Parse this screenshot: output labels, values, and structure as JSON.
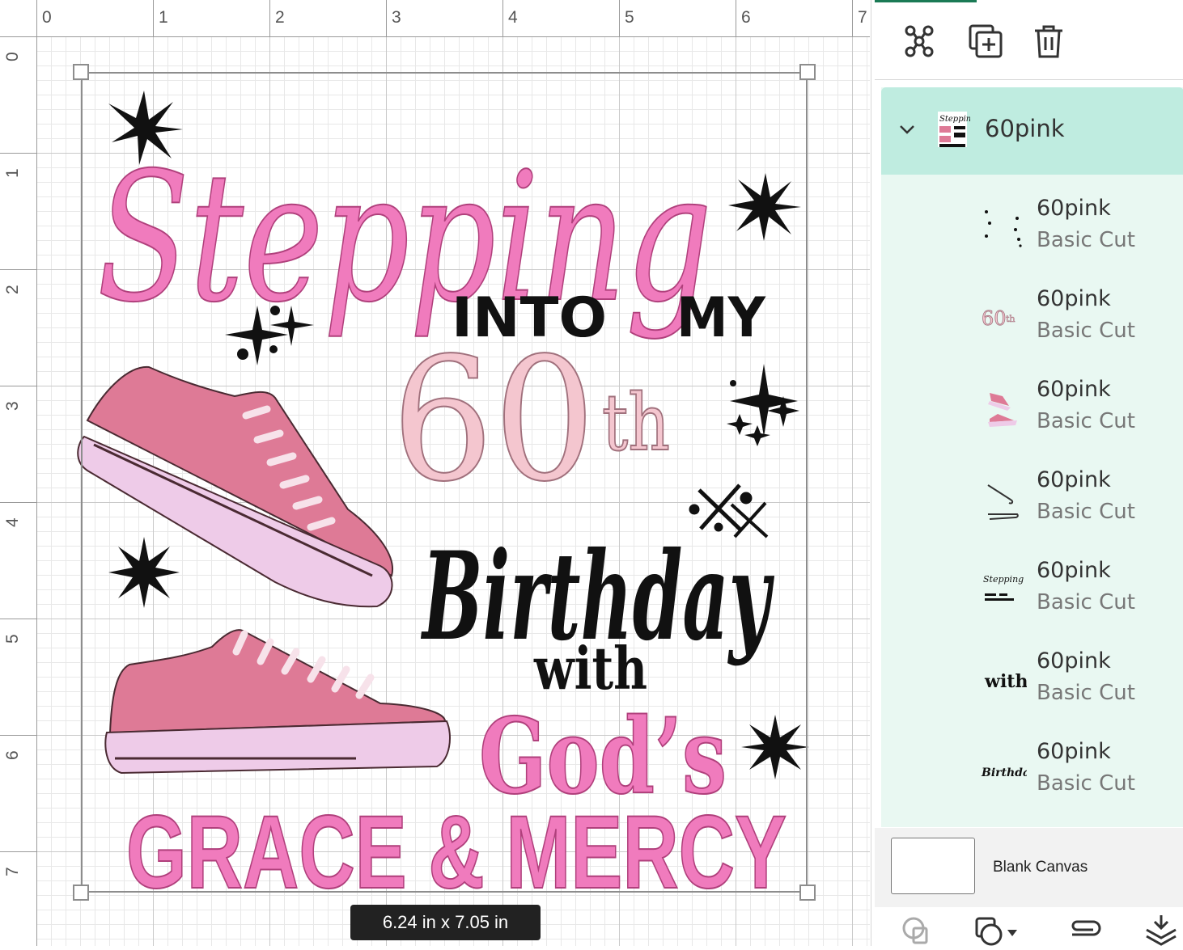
{
  "ruler": {
    "top_numbers": [
      "0",
      "1",
      "2",
      "3",
      "4",
      "5",
      "6",
      "7"
    ],
    "left_numbers": [
      "0",
      "1",
      "2",
      "3",
      "4",
      "5",
      "6",
      "7"
    ]
  },
  "design": {
    "line1": "Stepping",
    "line2_a": "INTO",
    "line2_b": "MY",
    "number": "60",
    "suffix": "th",
    "line4": "Birthday",
    "line5": "with",
    "line6": "God’s",
    "line7": "GRACE & MERCY",
    "colors": {
      "pink": "#f07bbd",
      "pink_outline": "#b0407c",
      "light_pink": "#f4c6cf",
      "shoe_body": "#de7a96",
      "shoe_sole": "#eecbe8",
      "ink": "#111111"
    }
  },
  "size_readout": "6.24  in x 7.05  in",
  "panel": {
    "toolbar": {
      "icons": [
        "group-icon",
        "duplicate-icon",
        "delete-icon"
      ]
    },
    "group": {
      "name": "60pink",
      "expanded": true
    },
    "layers": [
      {
        "name": "60pink",
        "type": "Basic Cut",
        "icon": "stars-thumbnail-icon"
      },
      {
        "name": "60pink",
        "type": "Basic Cut",
        "icon": "sixtieth-thumbnail-icon"
      },
      {
        "name": "60pink",
        "type": "Basic Cut",
        "icon": "shoes-thumbnail-icon"
      },
      {
        "name": "60pink",
        "type": "Basic Cut",
        "icon": "laces-thumbnail-icon"
      },
      {
        "name": "60pink",
        "type": "Basic Cut",
        "icon": "text-thumbnail-icon"
      },
      {
        "name": "60pink",
        "type": "Basic Cut",
        "icon": "with-thumbnail-icon",
        "thumb_text": "with"
      },
      {
        "name": "60pink",
        "type": "Basic Cut",
        "icon": "birthday-thumbnail-icon"
      }
    ],
    "blank_canvas": {
      "label": "Blank Canvas"
    },
    "bottom_toolbar": {
      "icons": [
        "slice-icon",
        "combine-icon",
        "attach-icon",
        "flatten-icon"
      ]
    }
  }
}
